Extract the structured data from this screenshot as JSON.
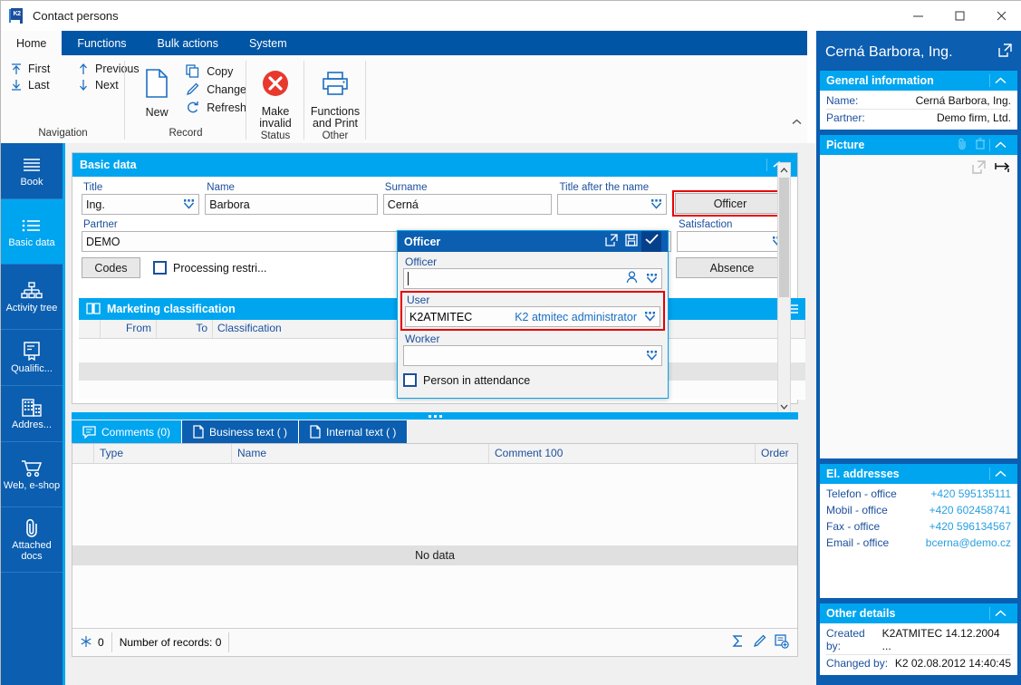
{
  "window": {
    "title": "Contact persons",
    "app_icon": "k2-logo-icon",
    "minimize": "−",
    "maximize": "□",
    "close": "✕"
  },
  "ribbon": {
    "tabs": [
      {
        "label": "Home",
        "active": true
      },
      {
        "label": "Functions",
        "active": false
      },
      {
        "label": "Bulk actions",
        "active": false
      },
      {
        "label": "System",
        "active": false
      }
    ],
    "groups": [
      {
        "label": "Navigation",
        "items": [
          {
            "label": "First",
            "icon": "arrow-up-to-line-icon"
          },
          {
            "label": "Previous",
            "icon": "arrow-up-icon"
          },
          {
            "label": "Last",
            "icon": "arrow-down-to-line-icon"
          },
          {
            "label": "Next",
            "icon": "arrow-down-icon"
          }
        ]
      },
      {
        "label": "Record",
        "big": {
          "label": "New",
          "icon": "new-document-icon"
        },
        "items": [
          {
            "label": "Copy",
            "icon": "copy-icon"
          },
          {
            "label": "Change",
            "icon": "pencil-icon"
          },
          {
            "label": "Refresh",
            "icon": "refresh-icon"
          }
        ]
      },
      {
        "label": "Status",
        "big": {
          "label": "Make invalid",
          "icon": "red-x-circle-icon"
        }
      },
      {
        "label": "Other",
        "big": {
          "label": "Functions and Print",
          "icon": "printer-icon"
        }
      }
    ]
  },
  "sidebar": {
    "items": [
      {
        "label": "Book",
        "icon": "book-lines-icon",
        "active": false
      },
      {
        "label": "Basic data",
        "icon": "list-icon",
        "active": true
      },
      {
        "label": "Activity tree",
        "icon": "org-tree-icon",
        "active": false
      },
      {
        "label": "Qualific...",
        "icon": "certificate-icon",
        "active": false
      },
      {
        "label": "Addres...",
        "icon": "building-icon",
        "active": false
      },
      {
        "label": "Web, e-shop",
        "icon": "shopping-cart-icon",
        "active": false
      },
      {
        "label": "Attached docs",
        "icon": "paperclip-icon",
        "active": false
      }
    ]
  },
  "basic_data": {
    "panel_title": "Basic data",
    "collapse_icon": "chevron-up-icon",
    "fields": {
      "title_label": "Title",
      "title_value": "Ing.",
      "name_label": "Name",
      "name_value": "Barbora",
      "surname_label": "Surname",
      "surname_value": "Cerná",
      "title_after_label": "Title after the name",
      "title_after_value": "",
      "partner_label": "Partner",
      "partner_value": "DEMO",
      "partner_value2": "De",
      "satisfaction_label": "Satisfaction",
      "satisfaction_value": ""
    },
    "buttons": {
      "officer": "Officer",
      "absence": "Absence",
      "codes": "Codes"
    },
    "checkbox": {
      "processing_restriction": "Processing restri..."
    }
  },
  "officer_popup": {
    "title": "Officer",
    "icons": {
      "expand": "open-external-icon",
      "save": "save-disk-icon",
      "confirm": "checkmark-icon"
    },
    "officer_label": "Officer",
    "officer_value": "",
    "user_label": "User",
    "user_code": "K2ATMITEC",
    "user_name": "K2 atmitec administrator",
    "worker_label": "Worker",
    "worker_value": "",
    "person_in_attendance": "Person in attendance"
  },
  "marketing": {
    "title": "Marketing classification",
    "icon": "book-open-icon",
    "menu_icon": "hamburger-icon",
    "columns": [
      "",
      "From",
      "To",
      "Classification"
    ]
  },
  "bottom_tabs": [
    {
      "label": "Comments (0)",
      "icon": "comment-icon",
      "active": true
    },
    {
      "label": "Business text ( )",
      "icon": "document-icon",
      "active": false
    },
    {
      "label": "Internal text ( )",
      "icon": "document-icon",
      "active": false
    }
  ],
  "bottom_grid": {
    "columns": [
      "",
      "Type",
      "Name",
      "Comment 100",
      "Order"
    ],
    "empty_text": "No data"
  },
  "statusbar": {
    "snowflake_icon": "snowflake-icon",
    "snowflake_count": "0",
    "records_text": "Number of records: 0",
    "tools": [
      "sum-icon",
      "pencil-icon",
      "add-record-icon"
    ]
  },
  "right_panel": {
    "header_title": "Cerná Barbora, Ing.",
    "header_icon": "open-external-icon",
    "general": {
      "title": "General information",
      "rows": [
        {
          "label": "Name:",
          "value": "Cerná Barbora, Ing."
        },
        {
          "label": "Partner:",
          "value": "Demo firm, Ltd."
        }
      ]
    },
    "picture": {
      "title": "Picture",
      "icons": [
        "paperclip-icon",
        "trash-icon"
      ],
      "body_icons": [
        "open-external-icon",
        "resize-width-icon"
      ]
    },
    "el_addresses": {
      "title": "El. addresses",
      "rows": [
        {
          "label": "Telefon - office",
          "value": "+420 595135111"
        },
        {
          "label": "Mobil - office",
          "value": "+420 602458741"
        },
        {
          "label": "Fax - office",
          "value": "+420 596134567"
        },
        {
          "label": "Email - office",
          "value": "bcerna@demo.cz"
        }
      ]
    },
    "other_details": {
      "title": "Other details",
      "rows": [
        {
          "label": "Created by:",
          "value": "K2ATMITEC 14.12.2004 ..."
        },
        {
          "label": "Changed by:",
          "value": "K2 02.08.2012 14:40:45"
        }
      ]
    }
  },
  "colors": {
    "ribbon_blue": "#0055a5",
    "accent_cyan": "#00a5f0",
    "panel_blue": "#0b5eb0",
    "highlight_red": "#e60000",
    "link_blue": "#2a9fe0"
  }
}
